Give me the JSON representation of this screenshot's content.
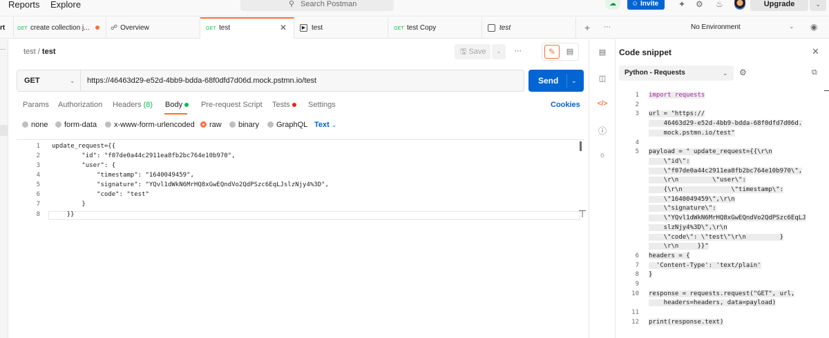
{
  "topbar": {
    "nav_reports": "Reports",
    "nav_explore": "Explore",
    "search_placeholder": "Search Postman",
    "invite_label": "Invite",
    "upgrade_label": "Upgrade"
  },
  "tabs": [
    {
      "label": "create collection j...",
      "method": "GET",
      "unsaved": true
    },
    {
      "label": "Overview"
    },
    {
      "label": "test",
      "method": "GET",
      "active": true
    },
    {
      "label": "test"
    },
    {
      "label": "test Copy",
      "method": "GET"
    },
    {
      "label": "test",
      "italic": true
    }
  ],
  "tabbar": {
    "left_clip": "rt",
    "environment": "No Environment"
  },
  "request": {
    "breadcrumb_parent": "test",
    "breadcrumb_sep": "/",
    "breadcrumb_current": "test",
    "save_label": "Save",
    "method": "GET",
    "url": "https://46463d29-e52d-4bb9-bdda-68f0dfd7d06d.mock.pstmn.io/test",
    "send_label": "Send"
  },
  "request_tabs": {
    "params": "Params",
    "authorization": "Authorization",
    "headers": "Headers",
    "headers_count": "(8)",
    "body": "Body",
    "prerequest": "Pre-request Script",
    "tests": "Tests",
    "settings": "Settings",
    "cookies": "Cookies"
  },
  "body_modes": {
    "none": "none",
    "form_data": "form-data",
    "urlencoded": "x-www-form-urlencoded",
    "raw": "raw",
    "binary": "binary",
    "graphql": "GraphQL",
    "format": "Text",
    "selected": "raw"
  },
  "editor_lines": [
    {
      "num": "1",
      "text": "update_request={{"
    },
    {
      "num": "2",
      "text": "        \"id\": \"f07de0a44c2911ea8fb2bc764e10b970\","
    },
    {
      "num": "3",
      "text": "        \"user\": {"
    },
    {
      "num": "4",
      "text": "            \"timestamp\": \"1640049459\","
    },
    {
      "num": "5",
      "text": "            \"signature\": \"YQvl1dWkN6MrHQ8xGwEQndVo2QdPSzc6EqLJslzNjy4%3D\","
    },
    {
      "num": "6",
      "text": "            \"code\": \"test\""
    },
    {
      "num": "7",
      "text": "        }"
    },
    {
      "num": "8",
      "text": "    }}"
    }
  ],
  "snippet": {
    "title": "Code snippet",
    "language": "Python - Requests",
    "lines": [
      {
        "num": "1",
        "text": "import requests"
      },
      {
        "num": "2",
        "text": ""
      },
      {
        "num": "3",
        "text": "url = \"https://"
      },
      {
        "num": "",
        "text": "    46463d29-e52d-4bb9-bdda-68f0dfd7d06d."
      },
      {
        "num": "",
        "text": "    mock.pstmn.io/test\""
      },
      {
        "num": "4",
        "text": ""
      },
      {
        "num": "5",
        "text": "payload = \" update_request={{\\r\\n"
      },
      {
        "num": "",
        "text": "    \\\"id\\\":"
      },
      {
        "num": "",
        "text": "    \\\"f07de0a44c2911ea8fb2bc764e10b970\\\","
      },
      {
        "num": "",
        "text": "    \\r\\n         \\\"user\\\":"
      },
      {
        "num": "",
        "text": "    {\\r\\n             \\\"timestamp\\\":"
      },
      {
        "num": "",
        "text": "    \\\"1640049459\\\",\\r\\n"
      },
      {
        "num": "",
        "text": "    \\\"signature\\\":"
      },
      {
        "num": "",
        "text": "    \\\"YQvl1dWkN6MrHQ8xGwEQndVo2QdPSzc6EqLJ"
      },
      {
        "num": "",
        "text": "    slzNjy4%3D\\\",\\r\\n"
      },
      {
        "num": "",
        "text": "    \\\"code\\\": \\\"test\\\"\\r\\n         }"
      },
      {
        "num": "",
        "text": "    \\r\\n     }}\""
      },
      {
        "num": "6",
        "text": "headers = {"
      },
      {
        "num": "7",
        "text": "  'Content-Type': 'text/plain'"
      },
      {
        "num": "8",
        "text": "}"
      },
      {
        "num": "9",
        "text": ""
      },
      {
        "num": "10",
        "text": "response = requests.request(\"GET\", url,"
      },
      {
        "num": "",
        "text": "    headers=headers, data=payload)"
      },
      {
        "num": "11",
        "text": ""
      },
      {
        "num": "12",
        "text": "print(response.text)"
      }
    ]
  },
  "colors": {
    "accent": "#ff6c37",
    "primary_blue": "#0265d2",
    "get_green": "#0cbb52"
  }
}
